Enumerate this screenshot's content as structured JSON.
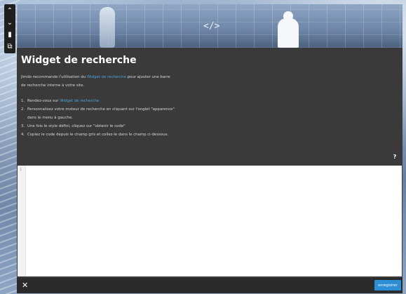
{
  "toolbar": {
    "items": [
      {
        "icon": "chevron-up-icon",
        "glyph": "⌃"
      },
      {
        "icon": "chevron-down-icon",
        "glyph": "⌄"
      },
      {
        "icon": "trash-icon",
        "glyph": "▮"
      },
      {
        "icon": "copy-icon",
        "glyph": "⧉"
      }
    ]
  },
  "hero": {
    "code_icon": "</>"
  },
  "dialog": {
    "title": "Widget de recherche",
    "intro_prefix": "Jimdo recommande l'utilisation du ",
    "intro_link": "Widget de recherche",
    "intro_suffix": " pour ajouter une barre",
    "intro_line2": "de recherche interne à votre site.",
    "steps": [
      {
        "num": "1.",
        "prefix": "Rendez-vous sur ",
        "link": "Widget de recherche",
        "text": ""
      },
      {
        "num": "2.",
        "prefix": "",
        "link": "",
        "text": "Personnalisez votre moteur de recherche en cliquant sur l'onglet \"apparence\""
      },
      {
        "num": "",
        "prefix": "",
        "link": "",
        "text": "dans le menu à gauche."
      },
      {
        "num": "3.",
        "prefix": "",
        "link": "",
        "text": "Une fois le style défini, cliquez sur \"obtenir le code\""
      },
      {
        "num": "4.",
        "prefix": "",
        "link": "",
        "text": "Copiez le code depuis le champ gris et collez-le dans le champ ci-dessous."
      }
    ],
    "help_label": "?",
    "editor": {
      "line_number": "1",
      "value": ""
    },
    "close_label": "✕",
    "save_label": "enregistrer"
  },
  "colors": {
    "dialog_bg": "#3a3a3a",
    "link": "#4aa3df",
    "save_button": "#2c8fd6"
  }
}
